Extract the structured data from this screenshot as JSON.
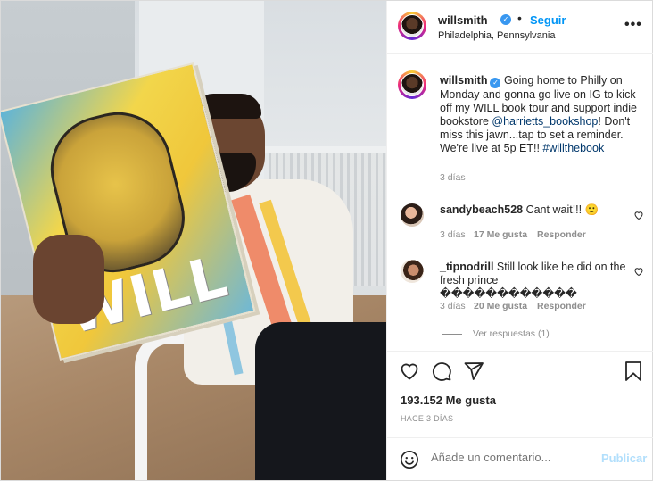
{
  "post": {
    "username": "willsmith",
    "follow_label": "Seguir",
    "location": "Philadelphia, Pennsylvania",
    "more_label": "•••",
    "book_title": "WILL"
  },
  "caption": {
    "username": "willsmith",
    "text_1": " Going home to Philly on Monday and gonna go live on IG to kick off my WILL book tour and support indie bookstore ",
    "mention": "@harrietts_bookshop",
    "text_2": "! Don't miss this jawn...tap to set a reminder. We're live at 5p ET!! ",
    "hashtag": "#willthebook",
    "time": "3 días"
  },
  "comments": [
    {
      "username": "sandybeach528",
      "text": " Cant wait!!! 🙂",
      "time": "3 días",
      "likes": "17 Me gusta",
      "reply_label": "Responder"
    },
    {
      "username": "_tipnodrill",
      "text": " Still look like he did on the fresh prince ������������",
      "time": "3 días",
      "likes": "20 Me gusta",
      "reply_label": "Responder"
    }
  ],
  "view_replies": "Ver respuestas (1)",
  "likes_count": "193.152 Me gusta",
  "posted_ago": "HACE 3 DÍAS",
  "add_comment": {
    "placeholder": "Añade un comentario...",
    "publish_label": "Publicar"
  },
  "icons": {
    "verified": "verified-badge-icon",
    "like": "heart-icon",
    "comment": "comment-bubble-icon",
    "share": "paper-plane-icon",
    "save": "bookmark-icon",
    "emoji": "emoji-smile-icon",
    "more": "more-options-icon"
  },
  "colors": {
    "link": "#00376b",
    "follow": "#0095f6",
    "verified": "#3897f0",
    "muted": "#8e8e8e",
    "publish_disabled": "#b2dffc"
  }
}
